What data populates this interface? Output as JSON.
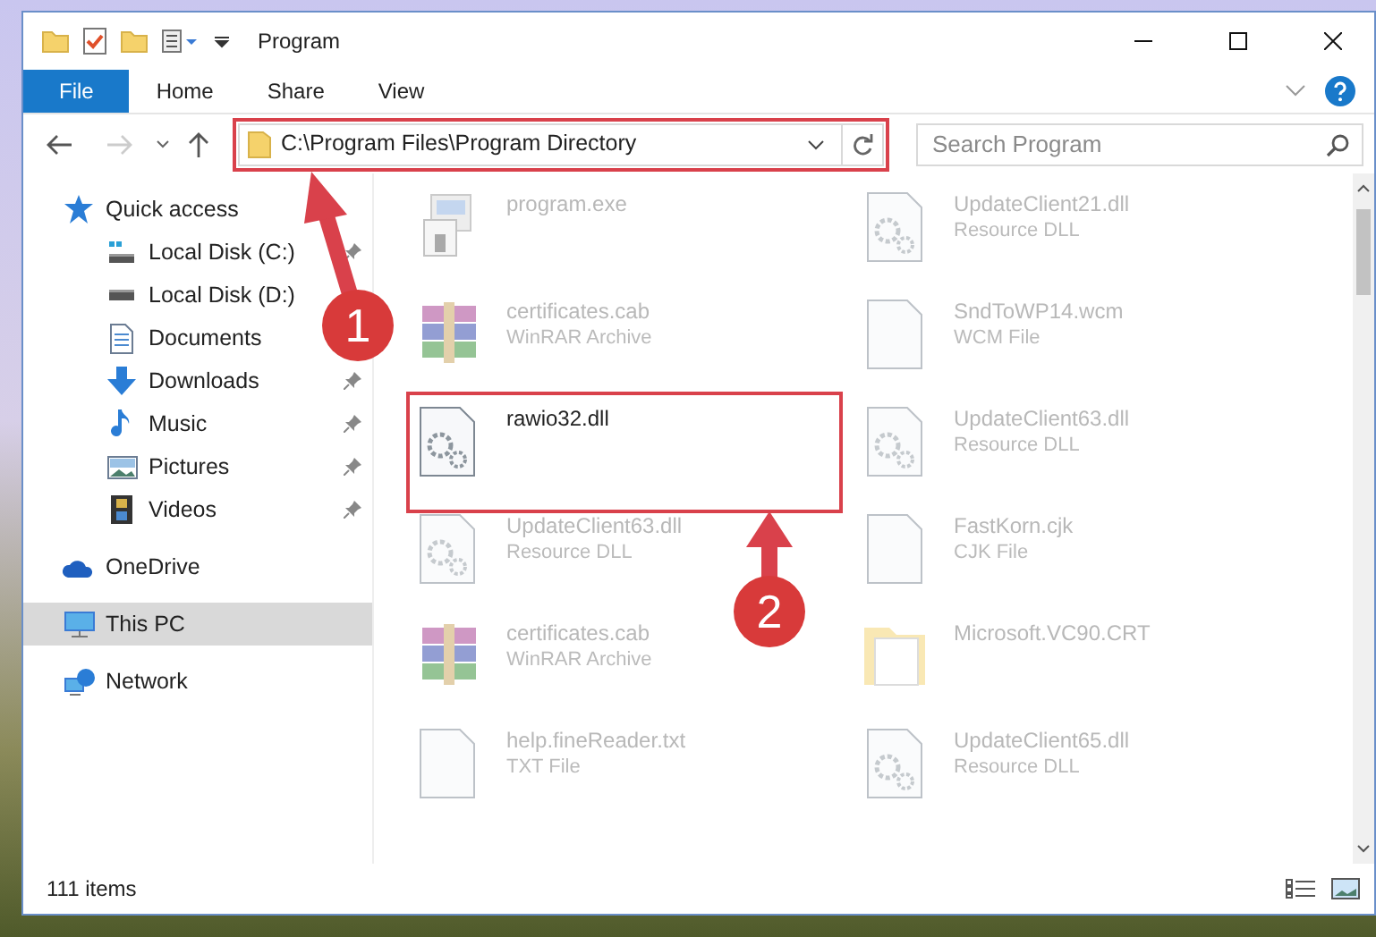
{
  "window": {
    "title": "Program"
  },
  "ribbon_tabs": [
    {
      "label": "File",
      "kind": "file"
    },
    {
      "label": "Home",
      "kind": "tab"
    },
    {
      "label": "Share",
      "kind": "tab"
    },
    {
      "label": "View",
      "kind": "tab"
    }
  ],
  "address_bar": {
    "path": "C:\\Program Files\\Program Directory",
    "highlighted": true
  },
  "search": {
    "placeholder": "Search Program"
  },
  "sidebar": {
    "items": [
      {
        "label": "Quick access",
        "kind": "star",
        "selected": false,
        "children": [
          {
            "label": "Local Disk (C:)",
            "kind": "disk-c",
            "pinned": true
          },
          {
            "label": "Local Disk (D:)",
            "kind": "disk"
          },
          {
            "label": "Documents",
            "kind": "documents"
          },
          {
            "label": "Downloads",
            "kind": "downloads",
            "pinned": true
          },
          {
            "label": "Music",
            "kind": "music",
            "pinned": true
          },
          {
            "label": "Pictures",
            "kind": "pictures",
            "pinned": true
          },
          {
            "label": "Videos",
            "kind": "videos",
            "pinned": true
          }
        ]
      },
      {
        "label": "OneDrive",
        "kind": "cloud",
        "selected": false
      },
      {
        "label": "This PC",
        "kind": "pc",
        "selected": true
      },
      {
        "label": "Network",
        "kind": "network",
        "selected": false
      }
    ]
  },
  "files": [
    {
      "name": "program.exe",
      "kind": "exe",
      "dimmed": true,
      "highlighted": false
    },
    {
      "name": "UpdateClient21.dll",
      "type": "Resource DLL",
      "kind": "dll",
      "dimmed": true,
      "highlighted": false
    },
    {
      "name": "certificates.cab",
      "type": "WinRAR Archive",
      "kind": "archive",
      "dimmed": true,
      "highlighted": false
    },
    {
      "name": "SndToWP14.wcm",
      "type": "WCM File",
      "kind": "blank",
      "dimmed": true,
      "highlighted": false
    },
    {
      "name": "rawio32.dll",
      "kind": "dll",
      "dimmed": false,
      "highlighted": true
    },
    {
      "name": "UpdateClient63.dll",
      "type": "Resource DLL",
      "kind": "dll",
      "dimmed": true,
      "highlighted": false
    },
    {
      "name": "UpdateClient63.dll",
      "type": "Resource DLL",
      "kind": "dll",
      "dimmed": true,
      "highlighted": false
    },
    {
      "name": "FastKorn.cjk",
      "type": "CJK File",
      "kind": "blank",
      "dimmed": true,
      "highlighted": false
    },
    {
      "name": "certificates.cab",
      "type": "WinRAR Archive",
      "kind": "archive",
      "dimmed": true,
      "highlighted": false
    },
    {
      "name": "Microsoft.VC90.CRT",
      "kind": "folder",
      "dimmed": true,
      "highlighted": false
    },
    {
      "name": "help.fineReader.txt",
      "type": "TXT File",
      "kind": "blank",
      "dimmed": true,
      "highlighted": false
    },
    {
      "name": "UpdateClient65.dll",
      "type": "Resource DLL",
      "kind": "dll",
      "dimmed": true,
      "highlighted": false
    }
  ],
  "status_bar": {
    "count": "111 items"
  },
  "annotations": [
    {
      "number": "1"
    },
    {
      "number": "2"
    }
  ]
}
